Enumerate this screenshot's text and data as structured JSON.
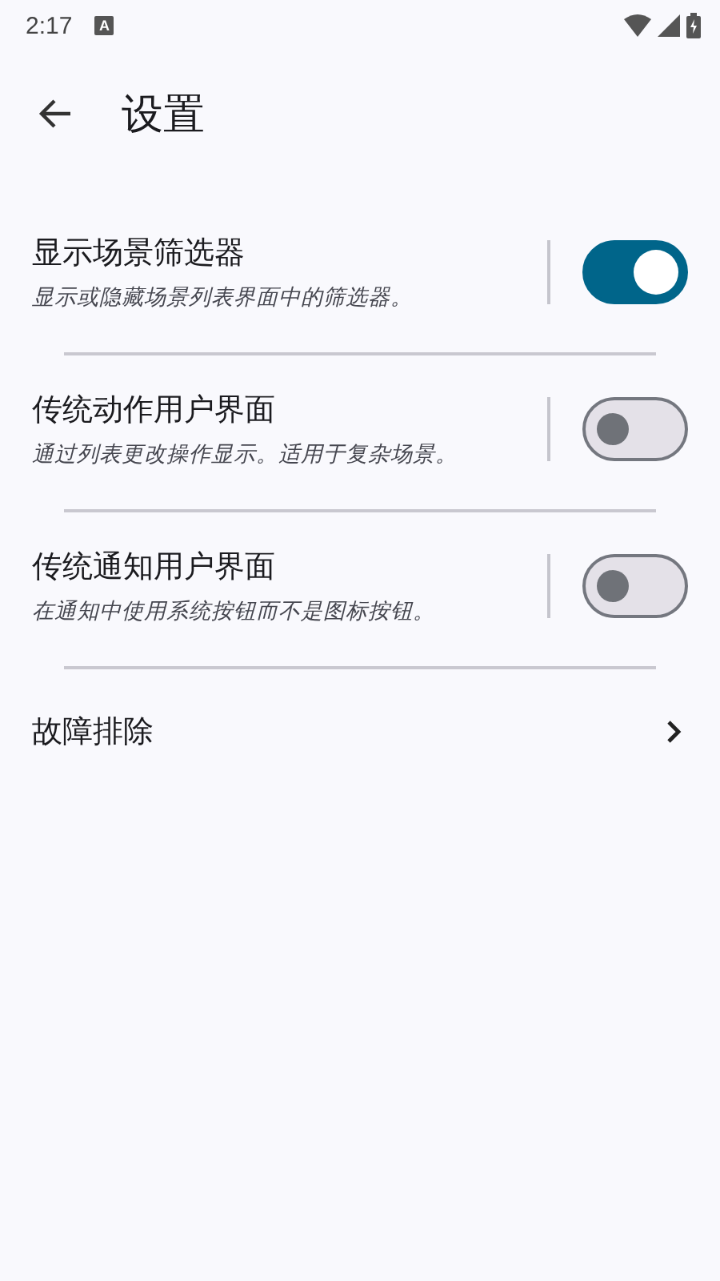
{
  "status_bar": {
    "time": "2:17",
    "notification_badge": "A"
  },
  "app_bar": {
    "title": "设置"
  },
  "settings": [
    {
      "kind": "toggle",
      "title": "显示场景筛选器",
      "subtitle": "显示或隐藏场景列表界面中的筛选器。",
      "on": true
    },
    {
      "kind": "toggle",
      "title": "传统动作用户界面",
      "subtitle": "通过列表更改操作显示。适用于复杂场景。",
      "on": false
    },
    {
      "kind": "toggle",
      "title": "传统通知用户界面",
      "subtitle": "在通知中使用系统按钮而不是图标按钮。",
      "on": false
    },
    {
      "kind": "link",
      "title": "故障排除"
    }
  ]
}
